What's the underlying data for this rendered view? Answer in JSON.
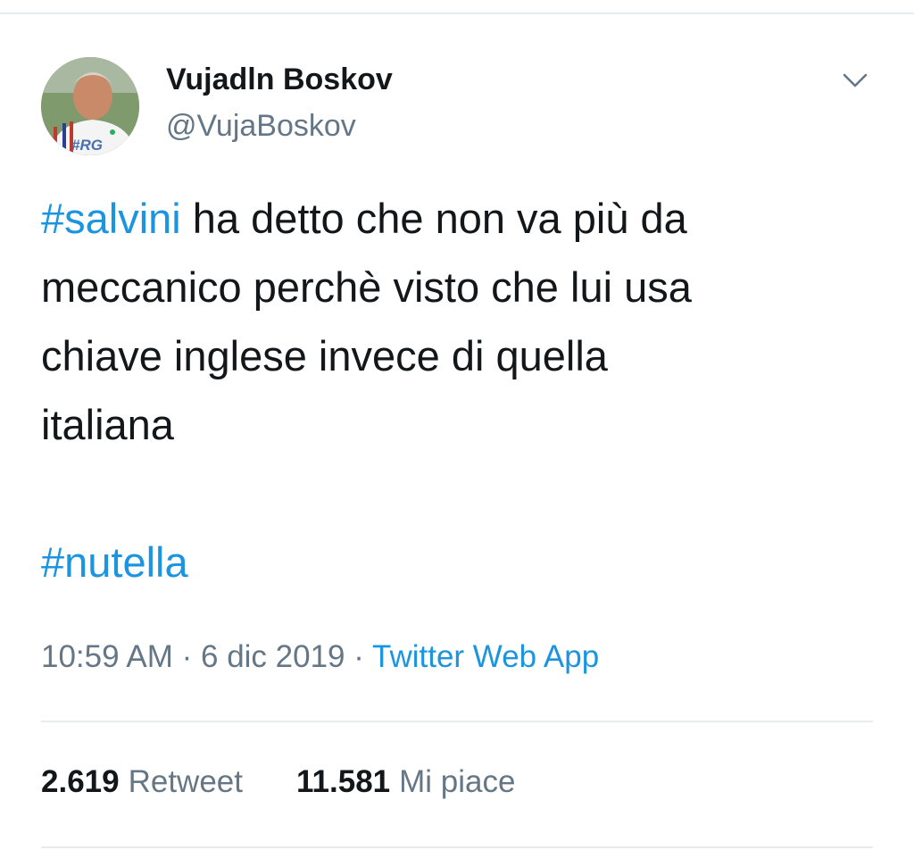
{
  "author": {
    "name": "Vujadln Boskov",
    "handle": "@VujaBoskov",
    "avatar_badge": "#RG"
  },
  "tweet": {
    "hashtag1": "#salvini",
    "line1_rest": " ha detto che non va più da",
    "line2": "meccanico perchè visto che lui usa",
    "line3": "chiave inglese invece di quella",
    "line4": "italiana",
    "hashtag2": "#nutella"
  },
  "meta": {
    "time": "10:59 AM",
    "separator": " · ",
    "date": "6 dic 2019",
    "source": "Twitter Web App"
  },
  "stats": {
    "retweets_count": "2.619",
    "retweets_label": "Retweet",
    "likes_count": "11.581",
    "likes_label": "Mi piace"
  },
  "icons": {
    "more": "chevron-down-icon"
  },
  "colors": {
    "link": "#1b95e0",
    "text": "#14171a",
    "muted": "#657786",
    "divider": "#e6ecf0"
  }
}
